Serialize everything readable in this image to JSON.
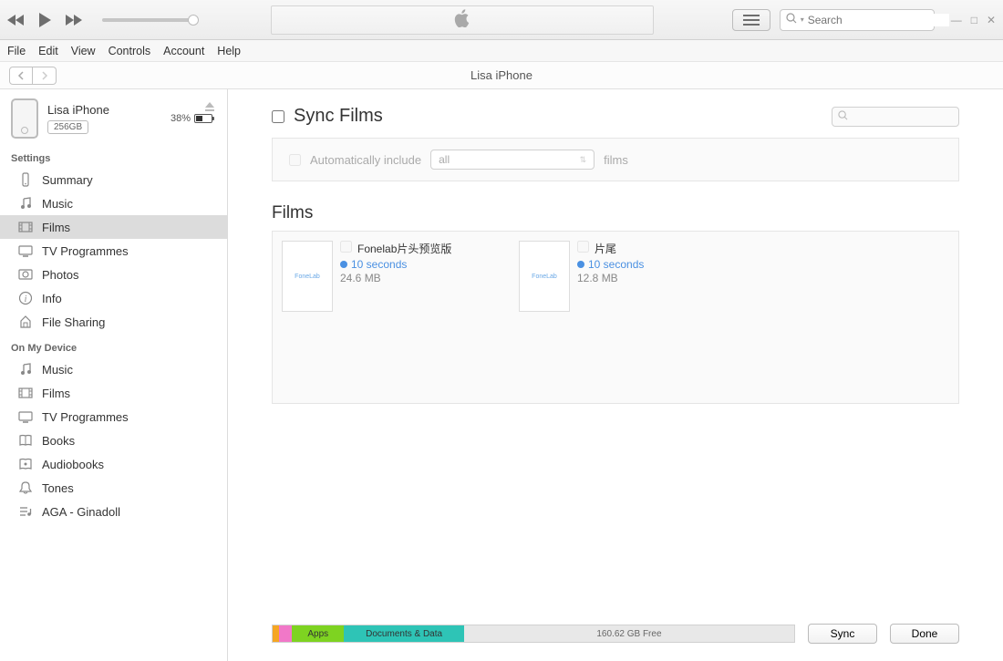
{
  "toolbar": {
    "search_placeholder": "Search"
  },
  "window": {
    "minimize": "—",
    "maximize": "□",
    "close": "✕"
  },
  "menu": [
    "File",
    "Edit",
    "View",
    "Controls",
    "Account",
    "Help"
  ],
  "subheader": {
    "title": "Lisa iPhone"
  },
  "device": {
    "name": "Lisa iPhone",
    "capacity": "256GB",
    "battery_pct": "38%"
  },
  "sidebar": {
    "settings_label": "Settings",
    "settings": [
      {
        "label": "Summary",
        "icon": "summary"
      },
      {
        "label": "Music",
        "icon": "music"
      },
      {
        "label": "Films",
        "icon": "films",
        "selected": true
      },
      {
        "label": "TV Programmes",
        "icon": "tv"
      },
      {
        "label": "Photos",
        "icon": "photos"
      },
      {
        "label": "Info",
        "icon": "info"
      },
      {
        "label": "File Sharing",
        "icon": "filesharing"
      }
    ],
    "ondevice_label": "On My Device",
    "ondevice": [
      {
        "label": "Music",
        "icon": "music"
      },
      {
        "label": "Films",
        "icon": "films"
      },
      {
        "label": "TV Programmes",
        "icon": "tv"
      },
      {
        "label": "Books",
        "icon": "books"
      },
      {
        "label": "Audiobooks",
        "icon": "audiobooks"
      },
      {
        "label": "Tones",
        "icon": "tones"
      },
      {
        "label": "AGA - Ginadoll",
        "icon": "playlist"
      }
    ]
  },
  "main": {
    "sync_title": "Sync Films",
    "auto_include_label": "Automatically include",
    "dropdown_value": "all",
    "films_suffix": "films",
    "films_heading": "Films",
    "films": [
      {
        "title": "Fonelab片头预览版",
        "duration": "10 seconds",
        "size": "24.6 MB",
        "thumb": "FoneLab"
      },
      {
        "title": "片尾",
        "duration": "10 seconds",
        "size": "12.8 MB",
        "thumb": "FoneLab"
      }
    ]
  },
  "storage": {
    "apps_label": "Apps",
    "docs_label": "Documents & Data",
    "free_label": "160.62 GB Free"
  },
  "buttons": {
    "sync": "Sync",
    "done": "Done"
  }
}
